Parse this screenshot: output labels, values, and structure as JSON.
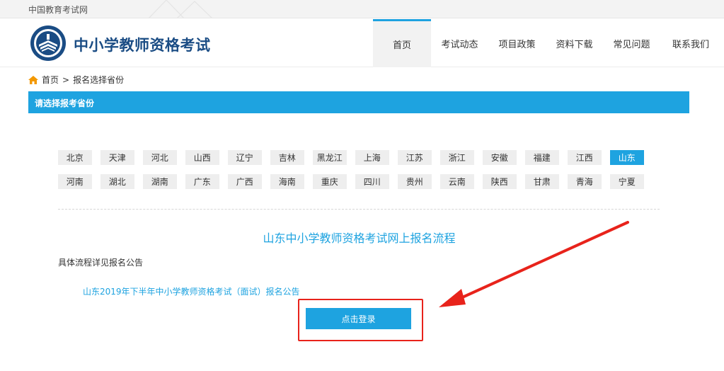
{
  "topbar": {
    "site_name": "中国教育考试网"
  },
  "header": {
    "brand": "中小学教师资格考试"
  },
  "nav": [
    {
      "label": "首页",
      "active": true
    },
    {
      "label": "考试动态",
      "active": false
    },
    {
      "label": "项目政策",
      "active": false
    },
    {
      "label": "资料下载",
      "active": false
    },
    {
      "label": "常见问题",
      "active": false
    },
    {
      "label": "联系我们",
      "active": false
    }
  ],
  "breadcrumb": {
    "home": "首页",
    "separator": ">",
    "current": "报名选择省份"
  },
  "banner": {
    "title": "请选择报考省份"
  },
  "provinces": {
    "row1": [
      "北京",
      "天津",
      "河北",
      "山西",
      "辽宁",
      "吉林",
      "黑龙江",
      "上海",
      "江苏",
      "浙江",
      "安徽",
      "福建",
      "江西",
      "山东"
    ],
    "row2": [
      "河南",
      "湖北",
      "湖南",
      "广东",
      "广西",
      "海南",
      "重庆",
      "四川",
      "贵州",
      "云南",
      "陕西",
      "甘肃",
      "青海",
      "宁夏"
    ],
    "selected": "山东"
  },
  "flow": {
    "title": "山东中小学教师资格考试网上报名流程",
    "note": "具体流程详见报名公告",
    "notice_link": "山东2019年下半年中小学教师资格考试（面试）报名公告",
    "login_button": "点击登录"
  },
  "colors": {
    "accent": "#1ea3e0",
    "brand": "#1a4c84",
    "annotation": "#e8231b"
  },
  "icons": {
    "home": "home-icon",
    "logo": "exam-logo-icon",
    "arrow": "annotation-arrow-icon"
  }
}
